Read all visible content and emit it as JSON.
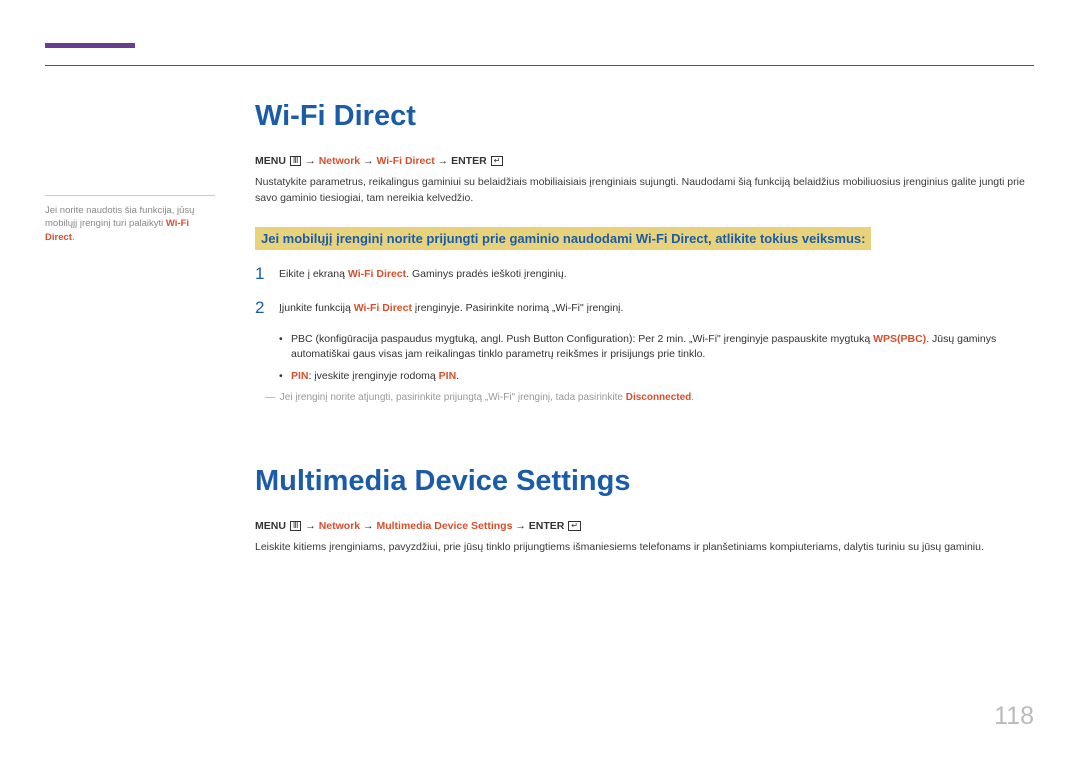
{
  "pageNumber": "118",
  "sidebar": {
    "line1": "Jei norite naudotis šia funkcija, jūsų",
    "line2_a": "mobilųjį įrenginį turi palaikyti ",
    "line2_b": "Wi-Fi Direct",
    "line2_c": "."
  },
  "section1": {
    "title": "Wi-Fi Direct",
    "path": {
      "menu": "MENU",
      "arrow": " → ",
      "network": "Network",
      "wifi": "Wi-Fi Direct",
      "enter": "ENTER"
    },
    "intro": "Nustatykite parametrus, reikalingus gaminiui su belaidžiais mobiliaisiais įrenginiais sujungti. Naudodami šią funkciją belaidžius mobiliuosius įrenginius galite jungti prie savo gaminio tiesiogiai, tam nereikia kelvedžio.",
    "highlight": "Jei mobilųjį įrenginį norite prijungti prie gaminio naudodami Wi-Fi Direct, atlikite tokius veiksmus:",
    "step1": {
      "num": "1",
      "a": "Eikite į ekraną ",
      "b": "Wi-Fi Direct",
      "c": ". Gaminys pradės ieškoti įrenginių."
    },
    "step2": {
      "num": "2",
      "a": "Įjunkite funkciją ",
      "b": "Wi-Fi Direct",
      "c": " įrenginyje. Pasirinkite norimą „Wi-Fi\" įrenginį."
    },
    "bullet1": {
      "a": "PBC (konfigūracija paspaudus mygtuką, angl. Push Button Configuration): Per 2 min. „Wi-Fi\" įrenginyje paspauskite mygtuką ",
      "b": "WPS(PBC)",
      "c": ". Jūsų gaminys automatiškai gaus visas jam reikalingas tinklo parametrų reikšmes ir prisijungs prie tinklo."
    },
    "bullet2": {
      "a": "PIN",
      "b": ": įveskite įrenginyje rodomą ",
      "c": "PIN",
      "d": "."
    },
    "note": {
      "a": "Jei įrenginį norite atjungti, pasirinkite prijungtą „Wi-Fi\" įrenginį, tada pasirinkite ",
      "b": "Disconnected",
      "c": "."
    }
  },
  "section2": {
    "title": "Multimedia Device Settings",
    "path": {
      "menu": "MENU",
      "arrow": " → ",
      "network": "Network",
      "mds": "Multimedia Device Settings",
      "enter": "ENTER"
    },
    "body": "Leiskite kitiems įrenginiams, pavyzdžiui, prie jūsų tinklo prijungtiems išmaniesiems telefonams ir planšetiniams kompiuteriams, dalytis turiniu su jūsų gaminiu."
  }
}
